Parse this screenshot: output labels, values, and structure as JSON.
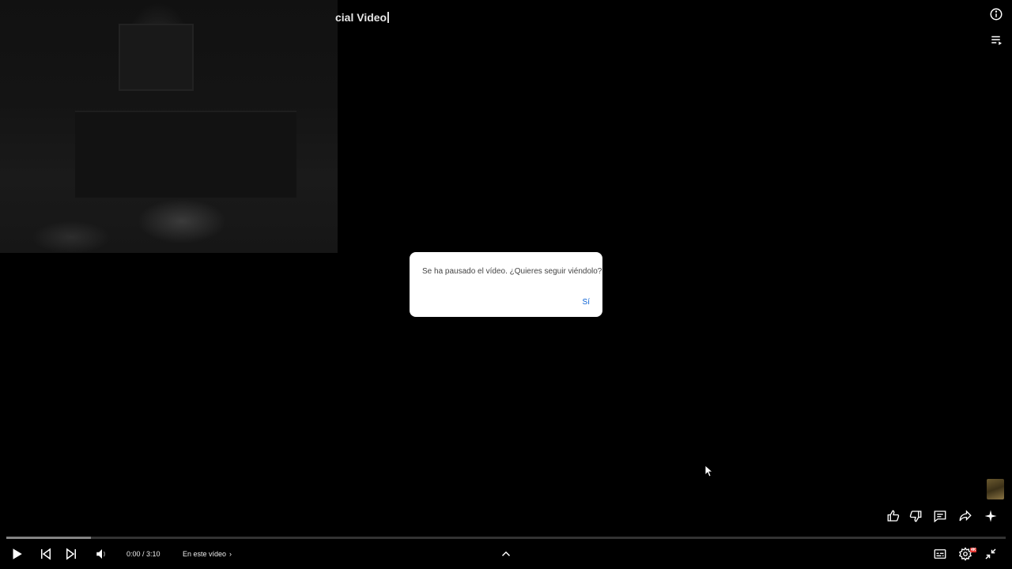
{
  "video": {
    "title_fragment": "cial Video"
  },
  "dialog": {
    "message": "Se ha pausado el vídeo. ¿Quieres seguir viéndolo?",
    "confirm_label": "Sí"
  },
  "player": {
    "time_display": "0:00 / 3:10",
    "chapter_label": "En este vídeo",
    "chapter_chevron": "›",
    "buffered_fraction": 0.085,
    "quality_badge": "4K"
  },
  "icons": {
    "info": "info-icon",
    "queue": "playlist-icon",
    "like": "thumbs-up-icon",
    "dislike": "thumbs-down-icon",
    "comments": "comments-icon",
    "share": "share-icon",
    "ask": "sparkle-icon",
    "play": "play-icon",
    "previous": "previous-icon",
    "next": "next-icon",
    "volume": "volume-icon",
    "expand": "chevron-up-icon",
    "subtitles": "subtitles-icon",
    "settings": "gear-icon",
    "exit_fullscreen": "exit-fullscreen-icon"
  }
}
